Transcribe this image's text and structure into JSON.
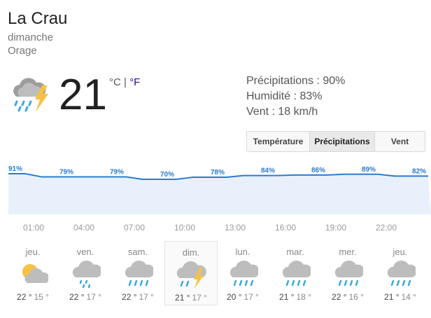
{
  "header": {
    "location": "La Crau",
    "day": "dimanche",
    "condition": "Orage"
  },
  "current": {
    "temperature": "21",
    "unit_c": "°C",
    "unit_sep": " | ",
    "unit_f": "°F",
    "icon": "thunderstorm-icon",
    "precipitation": "Précipitations : 90%",
    "humidity": "Humidité : 83%",
    "wind": "Vent : 18 km/h"
  },
  "tabs": [
    {
      "label": "Température",
      "active": false
    },
    {
      "label": "Précipitations",
      "active": true
    },
    {
      "label": "Vent",
      "active": false
    }
  ],
  "chart_data": {
    "type": "area",
    "series": [
      {
        "values": [
          91,
          79,
          79,
          70,
          78,
          84,
          86,
          89,
          82
        ]
      }
    ],
    "x": [
      "01:00",
      "04:00",
      "07:00",
      "10:00",
      "13:00",
      "16:00",
      "19:00",
      "22:00",
      ""
    ],
    "labels": [
      "91%",
      "79%",
      "79%",
      "70%",
      "78%",
      "84%",
      "86%",
      "89%",
      "82%"
    ],
    "ylim": [
      0,
      100
    ],
    "colors": {
      "line": "#2a7bd1",
      "fill": "#e8f1fb",
      "label": "#2a7bd1"
    }
  },
  "days": [
    {
      "name": "jeu.",
      "high": "22 °",
      "low": "15 °",
      "icon": "partly-cloudy-icon",
      "selected": false
    },
    {
      "name": "ven.",
      "high": "22 °",
      "low": "17 °",
      "icon": "rain-light-icon",
      "selected": false
    },
    {
      "name": "sam.",
      "high": "22 °",
      "low": "17 °",
      "icon": "rain-icon",
      "selected": false
    },
    {
      "name": "dim.",
      "high": "21 °",
      "low": "17 °",
      "icon": "thunderstorm-icon",
      "selected": true
    },
    {
      "name": "lun.",
      "high": "20 °",
      "low": "17 °",
      "icon": "rain-icon",
      "selected": false
    },
    {
      "name": "mar.",
      "high": "21 °",
      "low": "18 °",
      "icon": "rain-icon",
      "selected": false
    },
    {
      "name": "mer.",
      "high": "22 °",
      "low": "16 °",
      "icon": "rain-icon",
      "selected": false
    },
    {
      "name": "jeu.",
      "high": "21 °",
      "low": "14 °",
      "icon": "rain-icon",
      "selected": false
    }
  ]
}
